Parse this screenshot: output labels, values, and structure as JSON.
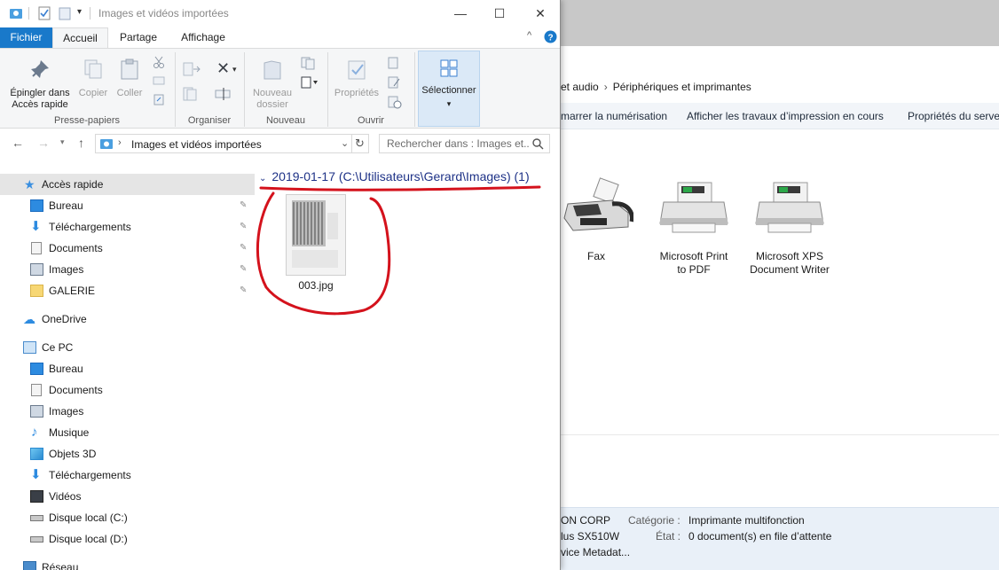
{
  "explorer": {
    "window_title": "Images et vidéos importées",
    "tabs": [
      {
        "label": "Fichier"
      },
      {
        "label": "Accueil"
      },
      {
        "label": "Partage"
      },
      {
        "label": "Affichage"
      }
    ],
    "ribbon": {
      "pin_label": "Épingler dans\nAccès rapide",
      "copy_label": "Copier",
      "paste_label": "Coller",
      "new_folder_label": "Nouveau\ndossier",
      "properties_label": "Propriétés",
      "select_label": "Sélectionner",
      "groups": [
        "Presse-papiers",
        "Organiser",
        "Nouveau",
        "Ouvrir"
      ]
    },
    "address": "Images et vidéos importées",
    "search_placeholder": "Rechercher dans : Images et...",
    "nav": {
      "quick_access": "Accès rapide",
      "quick_items": [
        "Bureau",
        "Téléchargements",
        "Documents",
        "Images",
        "GALERIE"
      ],
      "onedrive": "OneDrive",
      "this_pc": "Ce PC",
      "pc_items": [
        "Bureau",
        "Documents",
        "Images",
        "Musique",
        "Objets 3D",
        "Téléchargements",
        "Vidéos",
        "Disque local (C:)",
        "Disque local (D:)"
      ],
      "network": "Réseau"
    },
    "content": {
      "group_header": "2019-01-17 (C:\\Utilisateurs\\Gerard\\Images) (1)",
      "file_name": "003.jpg"
    }
  },
  "devices_window": {
    "breadcrumb": [
      "et audio",
      "Périphériques et imprimantes"
    ],
    "toolbar": [
      "marrer la numérisation",
      "Afficher les travaux d’impression en cours",
      "Propriétés du serveu"
    ],
    "devices": [
      {
        "name": "Fax",
        "icon": "fax-icon"
      },
      {
        "name": "Microsoft Print\nto PDF",
        "icon": "printer-icon"
      },
      {
        "name": "Microsoft XPS\nDocument Writer",
        "icon": "printer-icon"
      }
    ],
    "status": {
      "manufacturer": "ON CORP",
      "model": "lus SX510W",
      "metadata": "vice Metadat...",
      "category_label": "Catégorie :",
      "category_value": "Imprimante multifonction",
      "state_label": "État :",
      "state_value": "0 document(s) en file d’attente"
    }
  },
  "colors": {
    "accent": "#1979ca",
    "annotation": "#d4121c",
    "group_header": "#1e3287",
    "selection": "#e5e5e5"
  }
}
